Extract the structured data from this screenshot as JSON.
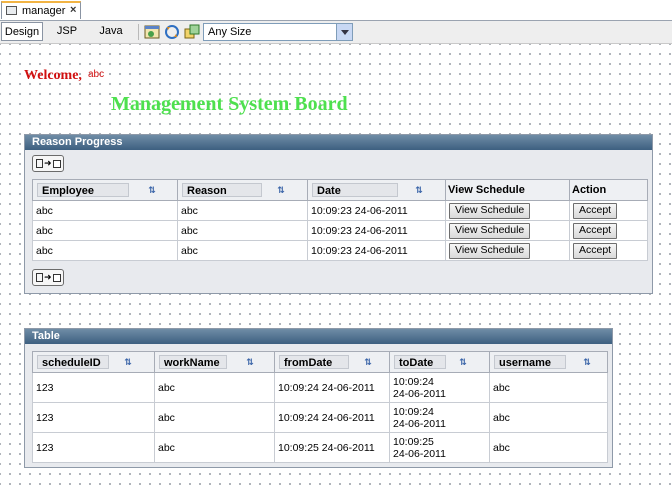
{
  "editor_tab": {
    "title": "manager",
    "close": "×"
  },
  "view_tabs": [
    "Design",
    "JSP",
    "Java"
  ],
  "toolbar": {
    "size_value": "Any Size"
  },
  "header": {
    "welcome": "Welcome,",
    "user": "abc",
    "title": "Management System Board"
  },
  "reason_panel": {
    "title": "Reason Progress",
    "columns": [
      "Employee",
      "Reason",
      "Date",
      "View Schedule",
      "Action"
    ],
    "sort_glyph": "⇅",
    "rows": [
      {
        "employee": "abc",
        "reason": "abc",
        "date": "10:09:23 24-06-2011",
        "view": "View Schedule",
        "action": "Accept"
      },
      {
        "employee": "abc",
        "reason": "abc",
        "date": "10:09:23 24-06-2011",
        "view": "View Schedule",
        "action": "Accept"
      },
      {
        "employee": "abc",
        "reason": "abc",
        "date": "10:09:23 24-06-2011",
        "view": "View Schedule",
        "action": "Accept"
      }
    ]
  },
  "table_panel": {
    "title": "Table",
    "columns": [
      "scheduleID",
      "workName",
      "fromDate",
      "toDate",
      "username"
    ],
    "rows": [
      {
        "scheduleID": "123",
        "workName": "abc",
        "fromDate": "10:09:24 24-06-2011",
        "toDate_time": "10:09:24",
        "toDate_date": "24-06-2011",
        "username": "abc"
      },
      {
        "scheduleID": "123",
        "workName": "abc",
        "fromDate": "10:09:24 24-06-2011",
        "toDate_time": "10:09:24",
        "toDate_date": "24-06-2011",
        "username": "abc"
      },
      {
        "scheduleID": "123",
        "workName": "abc",
        "fromDate": "10:09:25 24-06-2011",
        "toDate_time": "10:09:25",
        "toDate_date": "24-06-2011",
        "username": "abc"
      }
    ]
  }
}
